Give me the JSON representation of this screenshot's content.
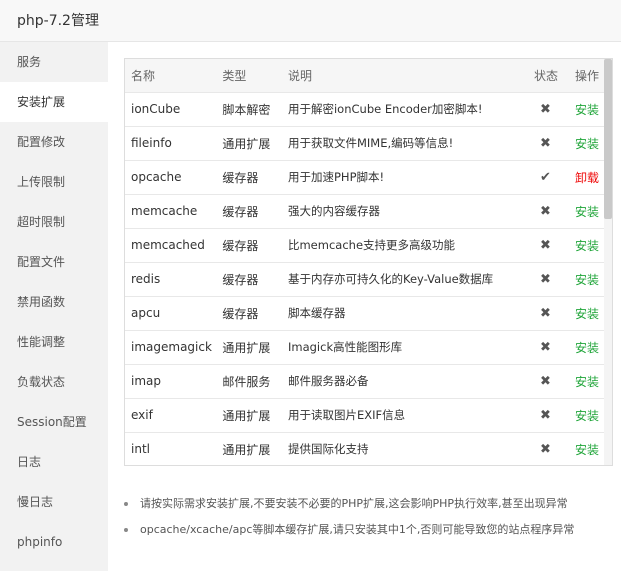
{
  "window": {
    "title": "php-7.2管理"
  },
  "sidebar": {
    "items": [
      {
        "label": "服务",
        "active": false
      },
      {
        "label": "安装扩展",
        "active": true
      },
      {
        "label": "配置修改",
        "active": false
      },
      {
        "label": "上传限制",
        "active": false
      },
      {
        "label": "超时限制",
        "active": false
      },
      {
        "label": "配置文件",
        "active": false
      },
      {
        "label": "禁用函数",
        "active": false
      },
      {
        "label": "性能调整",
        "active": false
      },
      {
        "label": "负载状态",
        "active": false
      },
      {
        "label": "Session配置",
        "active": false
      },
      {
        "label": "日志",
        "active": false
      },
      {
        "label": "慢日志",
        "active": false
      },
      {
        "label": "phpinfo",
        "active": false
      }
    ]
  },
  "table": {
    "headers": {
      "name": "名称",
      "type": "类型",
      "desc": "说明",
      "status": "状态",
      "op": "操作"
    },
    "rows": [
      {
        "name": "ionCube",
        "type": "脚本解密",
        "desc": "用于解密ionCube Encoder加密脚本!",
        "status": "✖",
        "installed": false,
        "op": "安装"
      },
      {
        "name": "fileinfo",
        "type": "通用扩展",
        "desc": "用于获取文件MIME,编码等信息!",
        "status": "✖",
        "installed": false,
        "op": "安装"
      },
      {
        "name": "opcache",
        "type": "缓存器",
        "desc": "用于加速PHP脚本!",
        "status": "✔",
        "installed": true,
        "op": "卸载"
      },
      {
        "name": "memcache",
        "type": "缓存器",
        "desc": "强大的内容缓存器",
        "status": "✖",
        "installed": false,
        "op": "安装"
      },
      {
        "name": "memcached",
        "type": "缓存器",
        "desc": "比memcache支持更多高级功能",
        "status": "✖",
        "installed": false,
        "op": "安装"
      },
      {
        "name": "redis",
        "type": "缓存器",
        "desc": "基于内存亦可持久化的Key-Value数据库",
        "status": "✖",
        "installed": false,
        "op": "安装"
      },
      {
        "name": "apcu",
        "type": "缓存器",
        "desc": "脚本缓存器",
        "status": "✖",
        "installed": false,
        "op": "安装"
      },
      {
        "name": "imagemagick",
        "type": "通用扩展",
        "desc": "Imagick高性能图形库",
        "status": "✖",
        "installed": false,
        "op": "安装"
      },
      {
        "name": "imap",
        "type": "邮件服务",
        "desc": "邮件服务器必备",
        "status": "✖",
        "installed": false,
        "op": "安装"
      },
      {
        "name": "exif",
        "type": "通用扩展",
        "desc": "用于读取图片EXIF信息",
        "status": "✖",
        "installed": false,
        "op": "安装"
      },
      {
        "name": "intl",
        "type": "通用扩展",
        "desc": "提供国际化支持",
        "status": "✖",
        "installed": false,
        "op": "安装"
      }
    ]
  },
  "notes": [
    "请按实际需求安装扩展,不要安装不必要的PHP扩展,这会影响PHP执行效率,甚至出现异常",
    "opcache/xcache/apc等脚本缓存扩展,请只安装其中1个,否则可能导致您的站点程序异常"
  ],
  "colors": {
    "install": "#20a53a",
    "uninstall": "#ef0808",
    "sidebar_bg": "#f2f2f2"
  }
}
